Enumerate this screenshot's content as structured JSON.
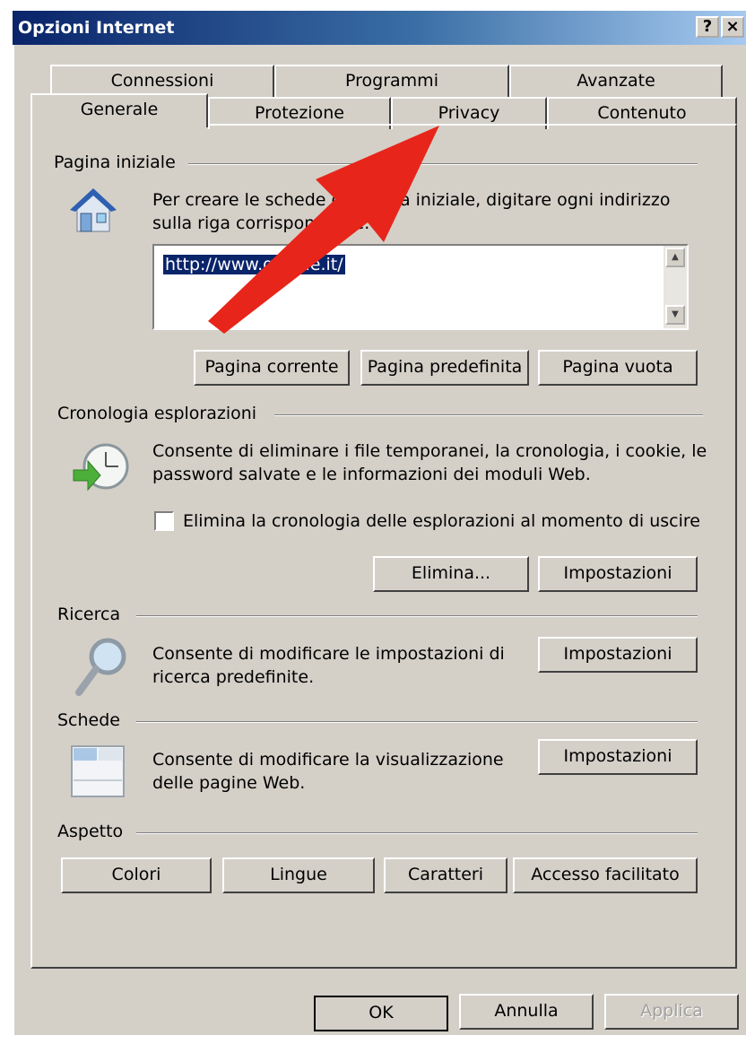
{
  "window": {
    "title": "Opzioni Internet",
    "help_button": "?",
    "close_button": "×"
  },
  "tabs": {
    "row_back": [
      "Connessioni",
      "Programmi",
      "Avanzate"
    ],
    "row_front": [
      "Generale",
      "Protezione",
      "Privacy",
      "Contenuto"
    ],
    "active": "Generale"
  },
  "home": {
    "label": "Pagina iniziale",
    "description_line1": "Per creare le schede di pagina iniziale, digitare ogni indirizzo",
    "description_line2": "sulla riga corrispondente.",
    "url": "http://www.google.it/",
    "btn_current": "Pagina corrente",
    "btn_default": "Pagina predefinita",
    "btn_blank": "Pagina vuota"
  },
  "history": {
    "label": "Cronologia esplorazioni",
    "description_line1": "Consente di eliminare i file temporanei, la cronologia, i cookie, le",
    "description_line2": "password salvate e le informazioni dei moduli Web.",
    "checkbox_label": "Elimina la cronologia delle esplorazioni al momento di uscire",
    "checkbox_checked": false,
    "btn_delete": "Elimina...",
    "btn_settings": "Impostazioni"
  },
  "search": {
    "label": "Ricerca",
    "description_line1": "Consente di modificare le impostazioni di",
    "description_line2": "ricerca predefinite.",
    "btn_settings": "Impostazioni"
  },
  "tabs_section": {
    "label": "Schede",
    "description_line1": "Consente di modificare la visualizzazione",
    "description_line2": "delle pagine Web.",
    "btn_settings": "Impostazioni"
  },
  "appearance": {
    "label": "Aspetto",
    "btn_colors": "Colori",
    "btn_languages": "Lingue",
    "btn_fonts": "Caratteri",
    "btn_accessibility": "Accesso facilitato"
  },
  "footer": {
    "ok": "OK",
    "cancel": "Annulla",
    "apply": "Applica"
  },
  "annotation": {
    "arrow_color": "#e8251a"
  }
}
